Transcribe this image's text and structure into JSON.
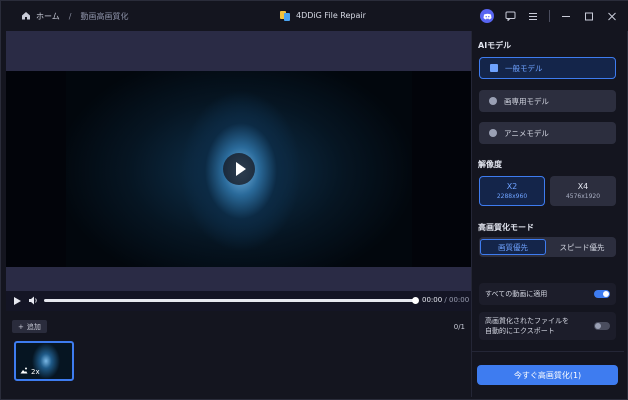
{
  "titlebar": {
    "home_label": "ホーム",
    "separator": "/",
    "current_page": "動画高画質化",
    "app_title": "4DDiG File Repair"
  },
  "player": {
    "time_current": "00:00",
    "time_separator": "/",
    "time_total": "00:00",
    "progress": 1.0
  },
  "files": {
    "add_label": "追加",
    "count": "0/1",
    "thumb_scale": "2x"
  },
  "sidebar": {
    "ai_model_title": "AIモデル",
    "models": [
      {
        "label": "一般モデル",
        "active": true
      },
      {
        "label": "画専用モデル",
        "active": false
      },
      {
        "label": "アニメモデル",
        "active": false
      }
    ],
    "resolution_title": "解像度",
    "resolutions": [
      {
        "label": "X2",
        "size": "2288x960",
        "active": true
      },
      {
        "label": "X4",
        "size": "4576x1920",
        "active": false
      }
    ],
    "mode_title": "高画質化モード",
    "modes": [
      {
        "label": "画質優先",
        "active": true
      },
      {
        "label": "スピード優先",
        "active": false
      }
    ],
    "apply_all_label": "すべての動画に適用",
    "apply_all_on": true,
    "auto_export_line1": "高画質化されたファイルを",
    "auto_export_line2": "自動的にエクスポート",
    "auto_export_on": false,
    "cta_label": "今すぐ高画質化(1)"
  },
  "colors": {
    "accent": "#3e7cf0",
    "background": "#14151f",
    "panel": "#2c2e3e"
  }
}
